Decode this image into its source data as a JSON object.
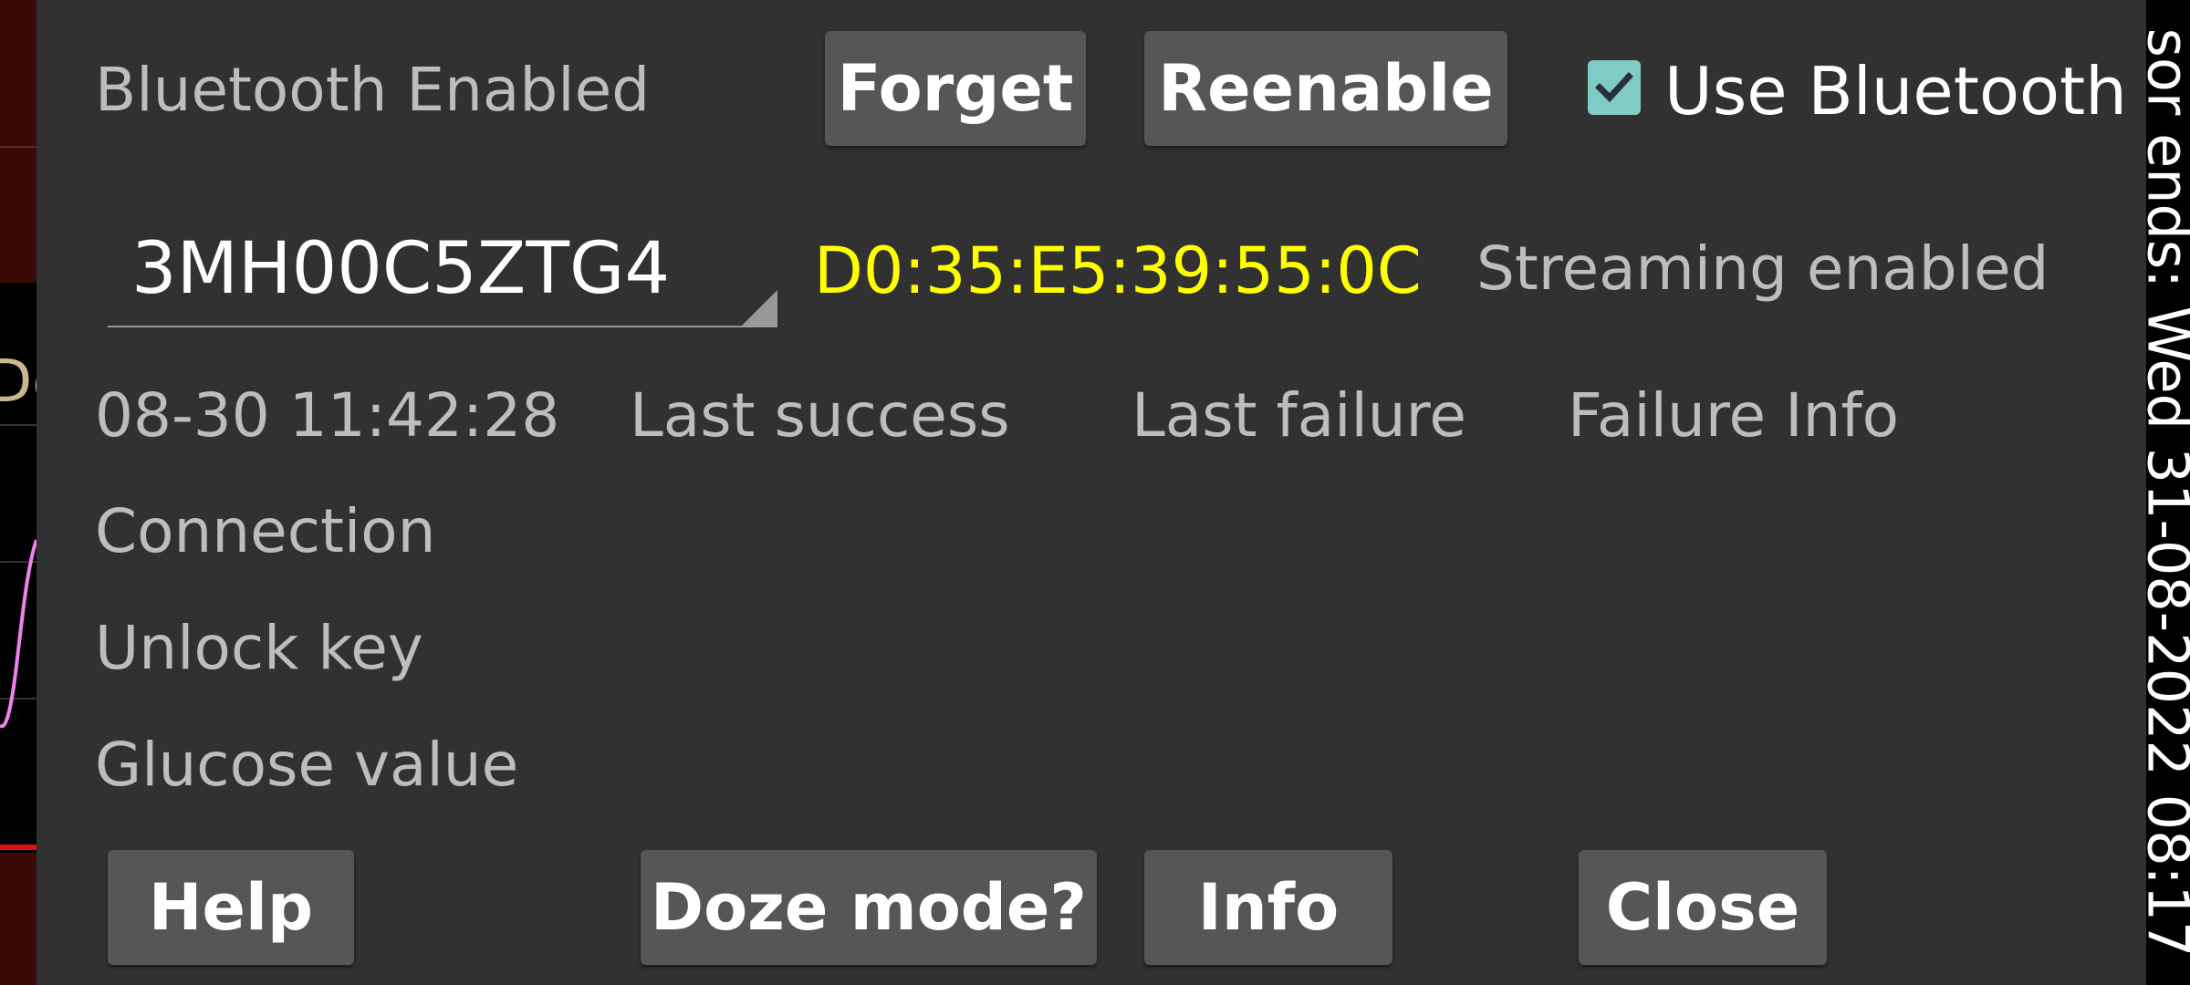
{
  "background": {
    "left_partial_text": "De",
    "right_vertical_text": "sor ends: Wed 31-08-2022 08:17"
  },
  "dialog": {
    "status_label": "Bluetooth Enabled",
    "forget_label": "Forget",
    "reenable_label": "Reenable",
    "use_bluetooth_label": "Use Bluetooth",
    "use_bluetooth_checked": true,
    "device_serial": "3MH00C5ZTG4",
    "mac_address": "D0:35:E5:39:55:0C",
    "streaming_label": "Streaming enabled",
    "timestamp": "08-30 11:42:28",
    "last_success_label": "Last success",
    "last_failure_label": "Last failure",
    "failure_info_label": "Failure Info",
    "connection_label": "Connection",
    "unlock_key_label": "Unlock key",
    "glucose_value_label": "Glucose value",
    "help_label": "Help",
    "doze_mode_label": "Doze mode?",
    "info_label": "Info",
    "close_label": "Close",
    "colors": {
      "dialog_bg": "#313131",
      "button_bg": "#565656",
      "mac_text": "#ffff00",
      "checkbox": "#80cbc4",
      "label_text": "#bdbdbd"
    }
  }
}
